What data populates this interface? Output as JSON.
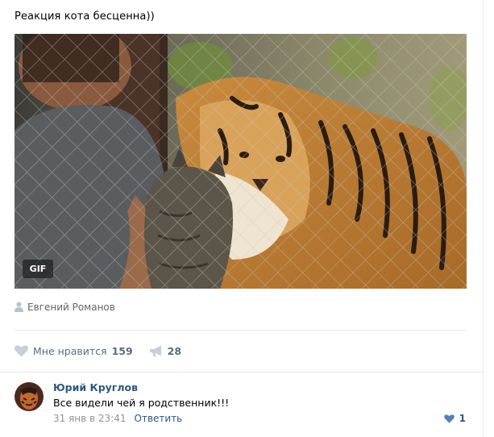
{
  "post": {
    "text": "Реакция кота бесценна))",
    "media": {
      "badge": "GIF"
    },
    "author": {
      "icon": "user-icon",
      "name": "Евгений Романов"
    },
    "actions": {
      "like": {
        "icon": "heart-icon",
        "label": "Мне нравится",
        "count": "159"
      },
      "share": {
        "icon": "megaphone-icon",
        "count": "28"
      }
    }
  },
  "comment": {
    "author": "Юрий Круглов",
    "text": "Все видели чей я родственник!!!",
    "date": "31 янв в 23:41",
    "reply_label": "Ответить",
    "like": {
      "icon": "heart-icon",
      "count": "1"
    }
  },
  "colors": {
    "link": "#2a5885",
    "action": "#5b6c80",
    "muted": "#939393",
    "divider": "#e7e8ec",
    "icon": "#b5c2d2"
  }
}
